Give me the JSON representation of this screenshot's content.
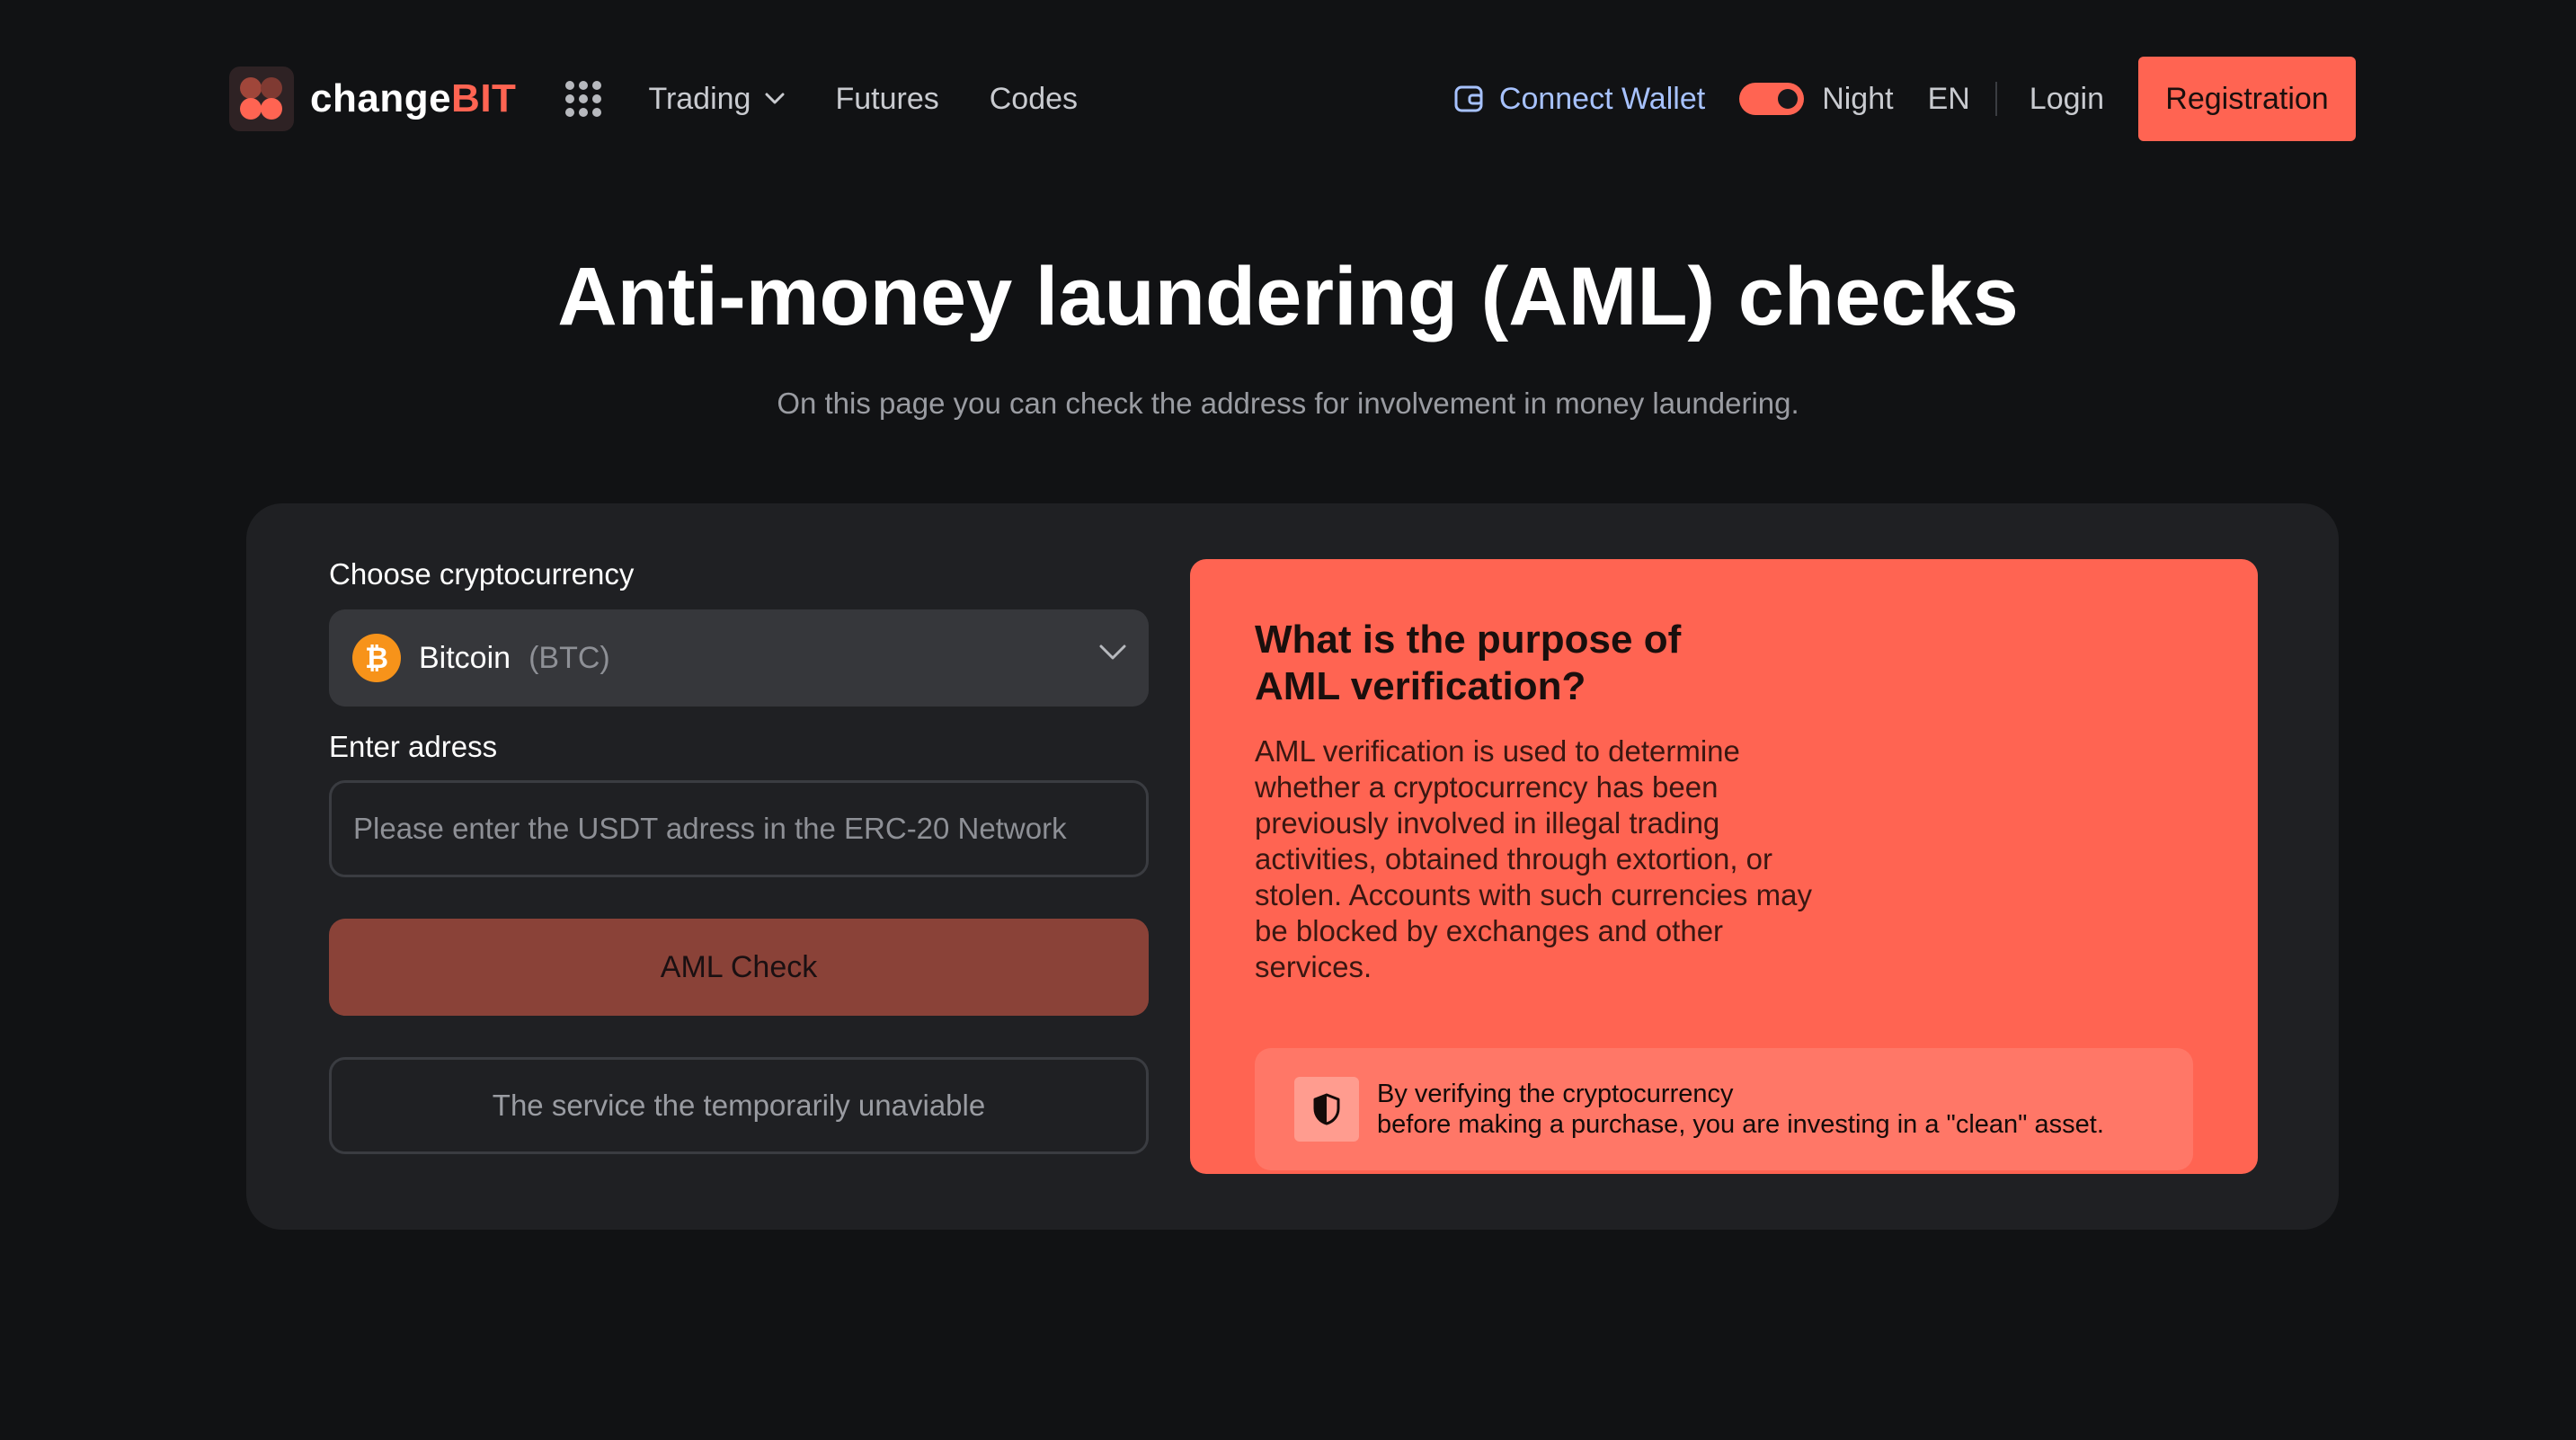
{
  "brand": {
    "name_prefix": "change",
    "name_highlight": "BIT",
    "accent_color": "#ff6452"
  },
  "nav": {
    "items": [
      {
        "label": "Trading",
        "has_dropdown": true
      },
      {
        "label": "Futures"
      },
      {
        "label": "Codes"
      }
    ]
  },
  "header": {
    "connect_wallet": "Connect Wallet",
    "theme_label": "Night",
    "theme_toggle_on": true,
    "language": "EN",
    "login": "Login",
    "register": "Registration"
  },
  "hero": {
    "title": "Anti-money laundering (AML) checks",
    "subtitle": "On this page you can check the address for involvement in money laundering."
  },
  "form": {
    "currency_label": "Choose cryptocurrency",
    "currency": {
      "name": "Bitcoin",
      "symbol": "(BTC)",
      "icon": "bitcoin-icon"
    },
    "address_label": "Enter adress",
    "address_value": "",
    "address_placeholder": "Please enter the USDT adress in the ERC-20 Network",
    "check_button": "AML Check",
    "status_text": "The service the temporarily unaviable"
  },
  "info": {
    "title": "What is the purpose of AML verification?",
    "body": "AML verification is used to determine whether a cryptocurrency has been previously involved in illegal trading activities, obtained through extortion, or stolen. Accounts with such currencies may be blocked by exchanges and other services.",
    "note_line1": "By verifying the cryptocurrency",
    "note_line2": "before making a purchase, you are investing in a \"clean\" asset."
  }
}
